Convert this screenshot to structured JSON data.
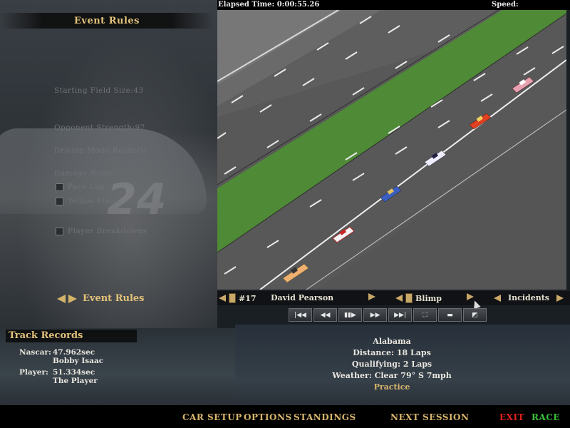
{
  "header": {
    "elapsed": "Elapsed Time: 0:00:55.26",
    "speed": "Speed:"
  },
  "rules": {
    "title": "Event Rules",
    "starting_field": "Starting Field Size:43",
    "opponent_strength": "Opponent Strength:97",
    "driving_mode": "Driving Mode:Realistic",
    "damage": "Damage:None",
    "pace_lap": "Pace Lap",
    "yellow_flags": "Yellow Flags",
    "player_breakdowns": "Player Breakdowns",
    "nav_label": "Event Rules"
  },
  "camera": {
    "car_number": "#17",
    "driver": "David Pearson",
    "view": "Blimp",
    "mode": "Incidents"
  },
  "replay_buttons": [
    "|◀◀",
    "◀◀",
    "▮▮▶",
    "▶▶",
    "▶▶|",
    "⛶",
    "▬",
    "◩"
  ],
  "track_records": {
    "title": "Track Records",
    "nascar_label": "Nascar:",
    "nascar_time": "47.962sec",
    "nascar_driver": "Bobby Isaac",
    "player_label": "Player:",
    "player_time": "51.334sec",
    "player_driver": "The Player"
  },
  "session": {
    "track": "Alabama",
    "distance": "Distance: 18 Laps",
    "qualifying": "Qualifying: 2 Laps",
    "weather": "Weather: Clear 79° S 7mph",
    "type": "Practice"
  },
  "footer": {
    "car_setup": "CAR SETUP",
    "options": "OPTIONS",
    "standings": "STANDINGS",
    "next_session": "NEXT SESSION",
    "exit": "EXIT",
    "race": "RACE"
  },
  "colors": {
    "accent": "#d7b56b",
    "exit": "#e0201a",
    "race": "#38c038",
    "grass": "#4f8a36",
    "asphalt": "#5a5a5a"
  }
}
